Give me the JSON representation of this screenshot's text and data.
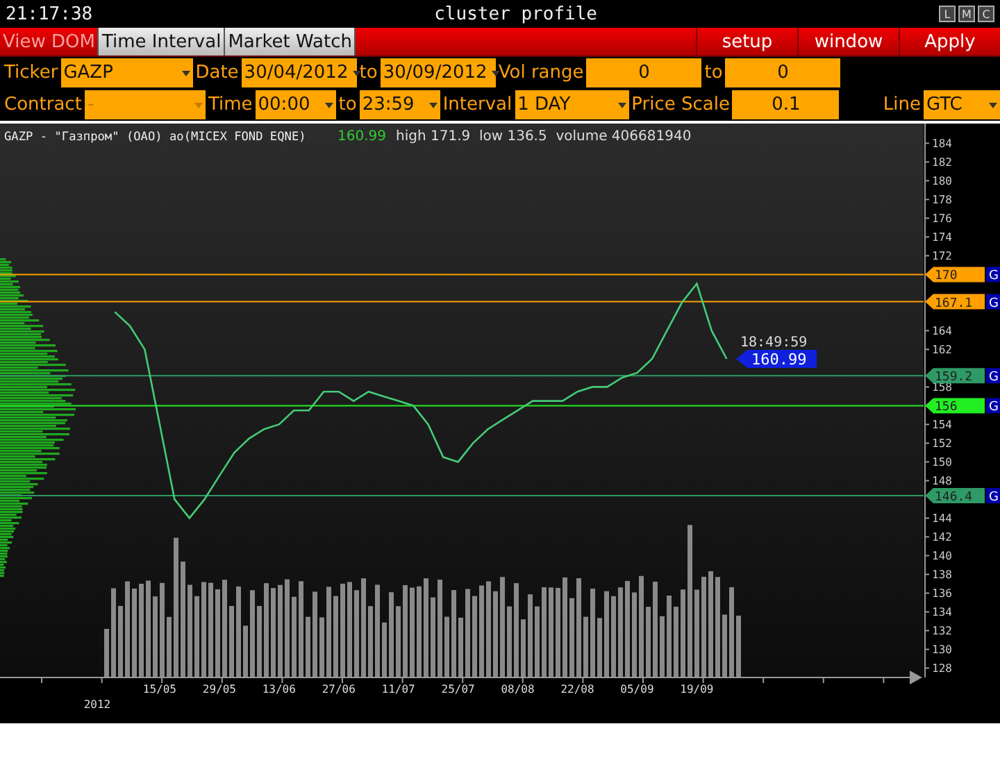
{
  "title_bar": {
    "clock": "21:17:38",
    "title": "cluster profile",
    "window_buttons": [
      "L",
      "M",
      "C"
    ]
  },
  "toolbar": {
    "tabs": [
      {
        "label": "View DOM",
        "selected": true
      },
      {
        "label": "Time Interval",
        "selected": false
      },
      {
        "label": "Market Watch",
        "selected": false
      }
    ],
    "buttons": [
      "setup",
      "window",
      "Apply"
    ]
  },
  "form_rows": [
    [
      {
        "kind": "label",
        "text": "Ticker"
      },
      {
        "kind": "dropdown",
        "value": "GAZP",
        "disabled": false
      },
      {
        "kind": "label",
        "text": "Date"
      },
      {
        "kind": "dropdown",
        "value": "30/04/2012",
        "disabled": false
      },
      {
        "kind": "label",
        "text": "to"
      },
      {
        "kind": "dropdown",
        "value": "30/09/2012",
        "disabled": false
      },
      {
        "kind": "label",
        "text": "Vol range"
      },
      {
        "kind": "input",
        "value": "0"
      },
      {
        "kind": "label",
        "text": "to"
      },
      {
        "kind": "input",
        "value": "0"
      }
    ],
    [
      {
        "kind": "label",
        "text": "Contract"
      },
      {
        "kind": "dropdown",
        "value": "-",
        "disabled": true
      },
      {
        "kind": "label",
        "text": "Time"
      },
      {
        "kind": "dropdown",
        "value": "00:00",
        "disabled": false
      },
      {
        "kind": "label",
        "text": "to"
      },
      {
        "kind": "dropdown",
        "value": "23:59",
        "disabled": false
      },
      {
        "kind": "label",
        "text": "Interval"
      },
      {
        "kind": "dropdown",
        "value": "1 DAY",
        "disabled": false
      },
      {
        "kind": "label",
        "text": "Price Scale"
      },
      {
        "kind": "input",
        "value": "0.1"
      },
      {
        "kind": "spacer"
      },
      {
        "kind": "label",
        "text": "Line"
      },
      {
        "kind": "dropdown",
        "value": "GTC",
        "disabled": false
      }
    ]
  ],
  "chart": {
    "instrument": "GAZP - \"Газпром\" (OAO) ao(MICEX FOND EQNE)",
    "last_price": "160.99",
    "stats": "high 171.9  low 136.5  volume 406681940",
    "year_label": "2012",
    "levels": [
      {
        "price": "170",
        "color": "#ff9f00",
        "badge": "G"
      },
      {
        "price": "167.1",
        "color": "#ff9f00",
        "badge": "G"
      },
      {
        "price": "159.2",
        "color": "#2e9a66",
        "badge": "G"
      },
      {
        "price": "156",
        "color": "#22ee22",
        "badge": "G"
      },
      {
        "price": "146.4",
        "color": "#2e9a66",
        "badge": "G"
      }
    ],
    "current": {
      "time": "18:49:59",
      "price": "160.99"
    },
    "chart_data": {
      "type": "line",
      "ylim": [
        127,
        186.1
      ],
      "categories": [
        null,
        null,
        null,
        null,
        "15/05",
        null,
        null,
        null,
        "29/05",
        null,
        null,
        null,
        "13/06",
        null,
        null,
        null,
        "27/06",
        null,
        null,
        null,
        "11/07",
        null,
        null,
        null,
        "25/07",
        null,
        null,
        null,
        "08/08",
        null,
        null,
        null,
        "22/08",
        null,
        null,
        null,
        "05/09",
        null,
        null,
        null,
        "19/09",
        null,
        null
      ],
      "yticks": [
        184,
        182,
        180,
        178,
        176,
        174,
        172,
        164,
        162,
        158,
        154,
        152,
        150,
        148,
        144,
        142,
        140,
        138,
        136,
        134,
        132,
        130,
        128
      ],
      "series": [
        {
          "color": "#44cc77",
          "values": [
            null,
            166,
            164.5,
            162,
            154,
            146,
            144,
            146,
            148.5,
            151,
            152.5,
            153.5,
            154,
            155.5,
            155.5,
            157.5,
            157.5,
            156.5,
            157.5,
            157,
            156.5,
            156,
            154,
            150.5,
            150,
            152,
            153.5,
            154.5,
            155.5,
            156.5,
            156.5,
            156.5,
            157.5,
            158,
            158,
            159,
            159.5,
            161,
            164,
            167,
            169,
            164,
            161
          ]
        }
      ]
    }
  }
}
